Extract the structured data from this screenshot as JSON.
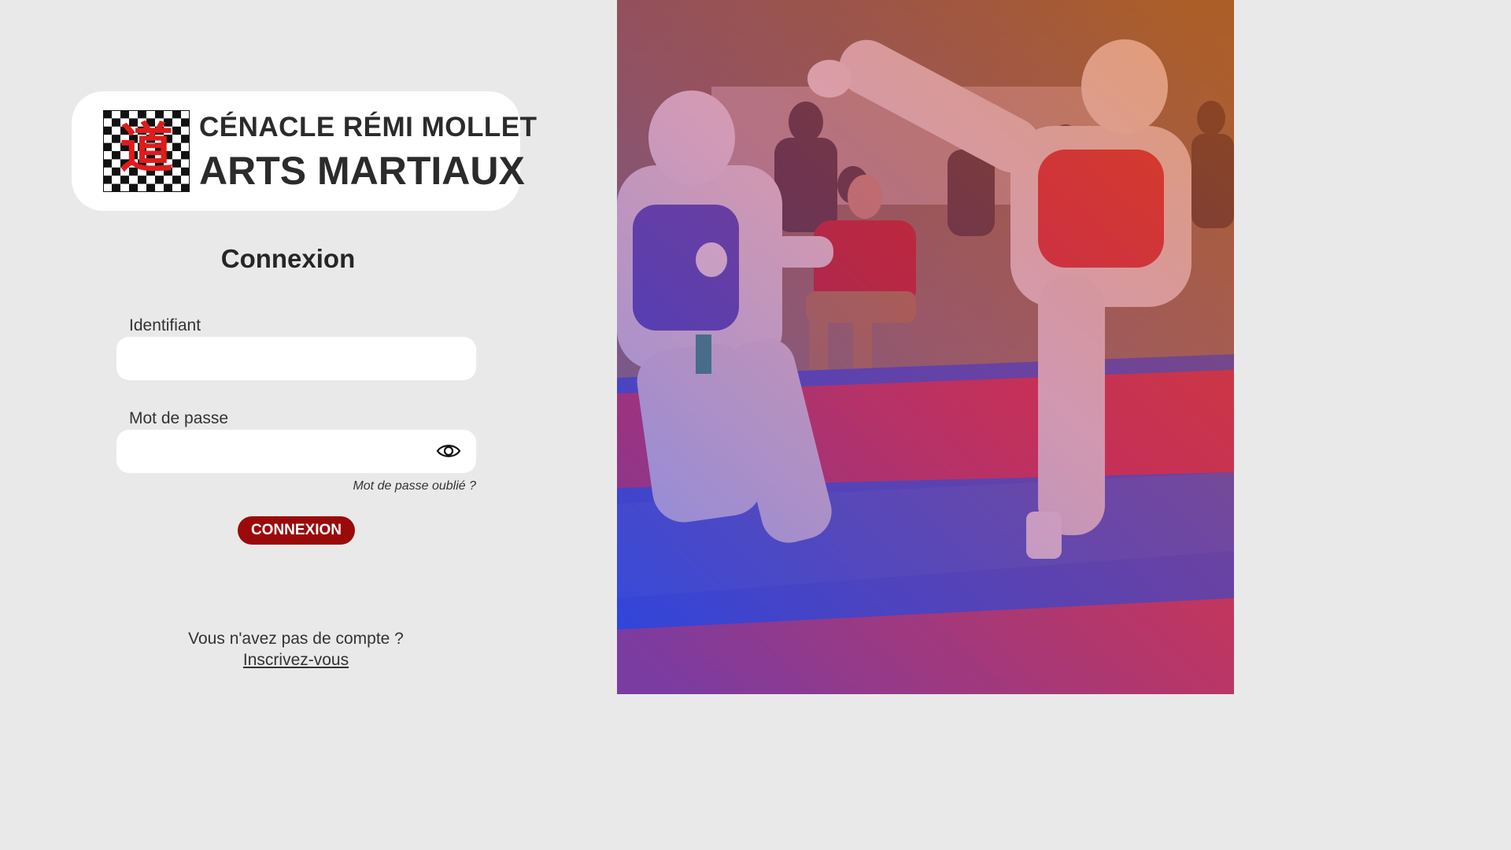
{
  "brand": {
    "line1": "CÉNACLE RÉMI MOLLET",
    "line2": "ARTS MARTIAUX",
    "logo_glyph": "道",
    "logo_icon": "checkered-dojo-logo"
  },
  "login": {
    "title": "Connexion",
    "username_label": "Identifiant",
    "username_value": "",
    "password_label": "Mot de passe",
    "password_value": "",
    "password_toggle_icon": "eye-icon",
    "forgot_password": "Mot de passe oublié ?",
    "submit_label": "CONNEXION"
  },
  "signup": {
    "prompt": "Vous n'avez pas de compte ?",
    "link": "Inscrivez-vous"
  },
  "colors": {
    "background": "#e9e9e9",
    "card": "#ffffff",
    "accent": "#9b0a0a",
    "photo_overlay_top": "#c0392b",
    "photo_overlay_bottom": "#3b3fd8"
  }
}
